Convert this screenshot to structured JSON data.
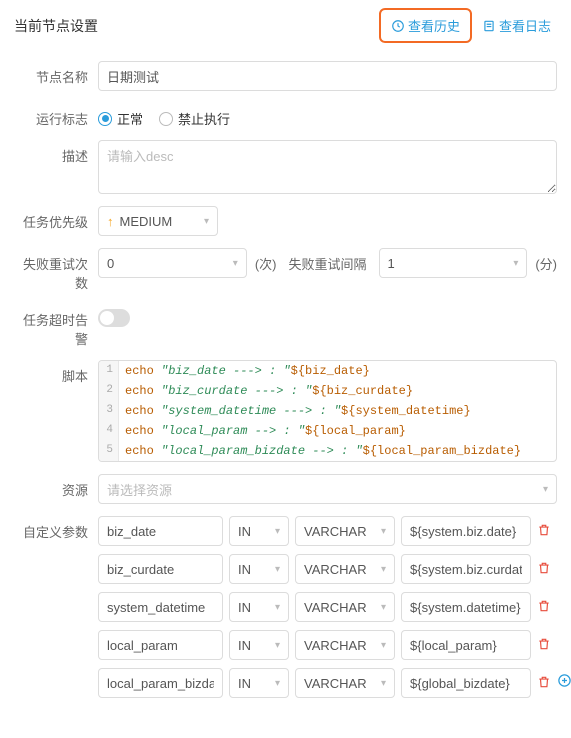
{
  "header": {
    "title": "当前节点设置",
    "historyLink": "查看历史",
    "logLink": "查看日志"
  },
  "labels": {
    "nodeName": "节点名称",
    "runFlag": "运行标志",
    "desc": "描述",
    "priority": "任务优先级",
    "retryCount": "失败重试次数",
    "retryCountUnit": "(次)",
    "retryInterval": "失败重试间隔",
    "retryIntervalUnit": "(分)",
    "timeoutAlarm": "任务超时告警",
    "script": "脚本",
    "resource": "资源",
    "customParams": "自定义参数"
  },
  "values": {
    "nodeName": "日期测试",
    "descPlaceholder": "请输入desc",
    "priority": "MEDIUM",
    "retryCount": "0",
    "retryInterval": "1",
    "resourcePlaceholder": "请选择资源"
  },
  "runFlag": {
    "normal": "正常",
    "forbid": "禁止执行",
    "selected": "normal"
  },
  "script": [
    {
      "n": "1",
      "kw": "echo",
      "str": "\"biz_date ---> : \"",
      "var": "${biz_date}"
    },
    {
      "n": "2",
      "kw": "echo",
      "str": "\"biz_curdate ---> : \"",
      "var": "${biz_curdate}"
    },
    {
      "n": "3",
      "kw": "echo",
      "str": "\"system_datetime ---> : \"",
      "var": "${system_datetime}"
    },
    {
      "n": "4",
      "kw": "echo",
      "str": "\"local_param --> : \"",
      "var": "${local_param}"
    },
    {
      "n": "5",
      "kw": "echo",
      "str": "\"local_param_bizdate --> : \"",
      "var": "${local_param_bizdate}"
    }
  ],
  "params": [
    {
      "name": "biz_date",
      "dir": "IN",
      "type": "VARCHAR",
      "val": "${system.biz.date}"
    },
    {
      "name": "biz_curdate",
      "dir": "IN",
      "type": "VARCHAR",
      "val": "${system.biz.curdate}"
    },
    {
      "name": "system_datetime",
      "dir": "IN",
      "type": "VARCHAR",
      "val": "${system.datetime}"
    },
    {
      "name": "local_param",
      "dir": "IN",
      "type": "VARCHAR",
      "val": "${local_param}"
    },
    {
      "name": "local_param_bizdate",
      "dir": "IN",
      "type": "VARCHAR",
      "val": "${global_bizdate}"
    }
  ]
}
